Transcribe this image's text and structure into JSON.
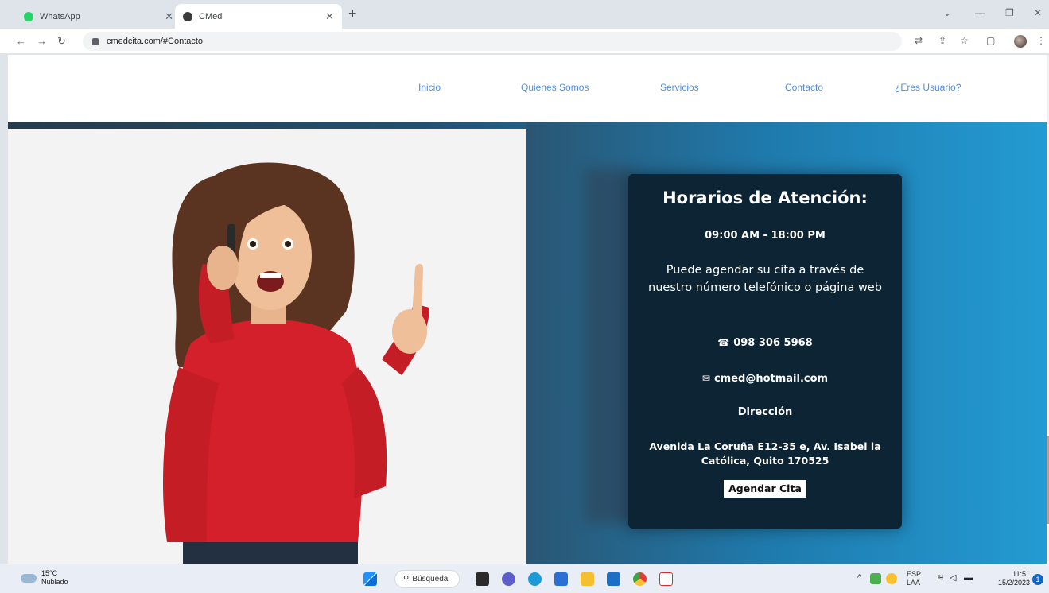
{
  "browser": {
    "tabs": [
      {
        "title": "WhatsApp",
        "active": false
      },
      {
        "title": "CMed",
        "active": true
      }
    ],
    "url": "cmedcita.com/#Contacto"
  },
  "site": {
    "nav": [
      "Inicio",
      "Quienes Somos",
      "Servicios",
      "Contacto",
      "¿Eres Usuario?"
    ]
  },
  "contact_card": {
    "title": "Horarios de Atención:",
    "hours": "09:00 AM - 18:00 PM",
    "description": "Puede agendar su cita a través de nuestro número telefónico o página web",
    "phone": "098 306 5968",
    "email": "cmed@hotmail.com",
    "address_label": "Dirección",
    "address": "Avenida La Coruña E12-35 e, Av. Isabel la Católica, Quito 170525",
    "button": "Agendar Cita"
  },
  "taskbar": {
    "weather_temp": "15°C",
    "weather_desc": "Nublado",
    "search_label": "Búsqueda",
    "lang_top": "ESP",
    "lang_bottom": "LAA",
    "time": "11:51",
    "date": "15/2/2023",
    "notifications": "1"
  }
}
